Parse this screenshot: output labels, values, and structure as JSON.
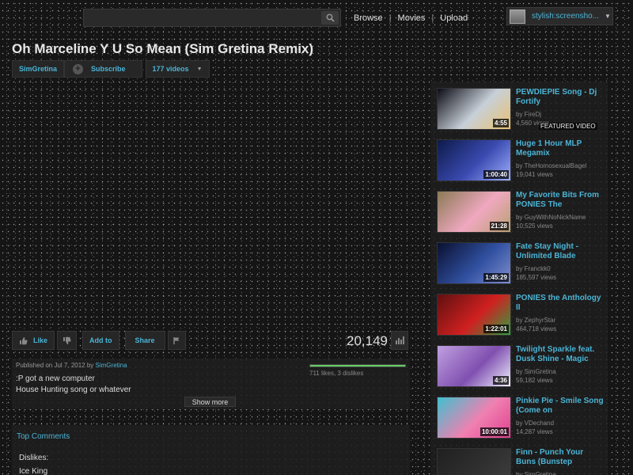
{
  "header": {
    "search_placeholder": "",
    "nav": [
      "Browse",
      "Movies",
      "Upload"
    ],
    "user_name": "stylish:screensho..."
  },
  "video": {
    "title": "Oh Marceline Y U So Mean (Sim Gretina Remix)",
    "channel": "SimGretina",
    "subscribe_label": "Subscribe",
    "videos_count": "177 videos",
    "views": "20,149",
    "actions": {
      "like": "Like",
      "add_to": "Add to",
      "share": "Share"
    },
    "published_prefix": "Published on Jul 7, 2012 by",
    "published_by": "SimGretina",
    "description_lines": [
      ":P got a new computer",
      "House Hunting song or whatever"
    ],
    "likes_text": "711 likes, 3 dislikes",
    "like_ratio": 0.996,
    "show_more": "Show more"
  },
  "comments": {
    "header": "Top Comments",
    "line1": "Dislikes:",
    "line2": "Ice King"
  },
  "related": [
    {
      "title": "PEWDIEPIE Song - Dj Fortify",
      "by": "by FireDj",
      "views": "4,560 views",
      "duration": "4:55",
      "featured": "FEATURED VIDEO",
      "colors": [
        "#0a0a14",
        "#c8d0d8",
        "#e8c070"
      ]
    },
    {
      "title": "Huge 1 Hour MLP Megamix",
      "by": "by TheHomosexualBagel",
      "views": "19,041 views",
      "duration": "1:00:40",
      "colors": [
        "#0d1a4a",
        "#3a4ab0",
        "#a0b0ff"
      ]
    },
    {
      "title": "My Favorite Bits From PONIES The",
      "by": "by GuyWithNoNickName",
      "views": "10,525 views",
      "duration": "21:28",
      "colors": [
        "#8a7a55",
        "#f0a8c0",
        "#b8a070"
      ]
    },
    {
      "title": "Fate Stay Night - Unlimited Blade",
      "by": "by Franckk0",
      "views": "185,597 views",
      "duration": "1:45:29",
      "colors": [
        "#0a1030",
        "#3050a0",
        "#8090d0"
      ]
    },
    {
      "title": "PONIES the Anthology II",
      "by": "by ZephyrStar",
      "views": "464,718 views",
      "duration": "1:22:01",
      "colors": [
        "#601010",
        "#d02020",
        "#30a040"
      ]
    },
    {
      "title": "Twilight Sparkle feat. Dusk Shine - Magic",
      "by": "by SimGretina",
      "views": "59,182 views",
      "duration": "4:36",
      "colors": [
        "#c0a0e0",
        "#8050b0",
        "#f0f0ff"
      ]
    },
    {
      "title": "Pinkie Pie - Smile Song (Come on",
      "by": "by VDechand",
      "views": "14,287 views",
      "duration": "10:00:01",
      "colors": [
        "#40c0d0",
        "#f080b0",
        "#e04090"
      ]
    },
    {
      "title": "Finn - Punch Your Buns (Bunstep",
      "by": "by SimGretina",
      "views": "",
      "duration": "",
      "colors": [
        "#202020",
        "#303030",
        "#404040"
      ]
    }
  ]
}
